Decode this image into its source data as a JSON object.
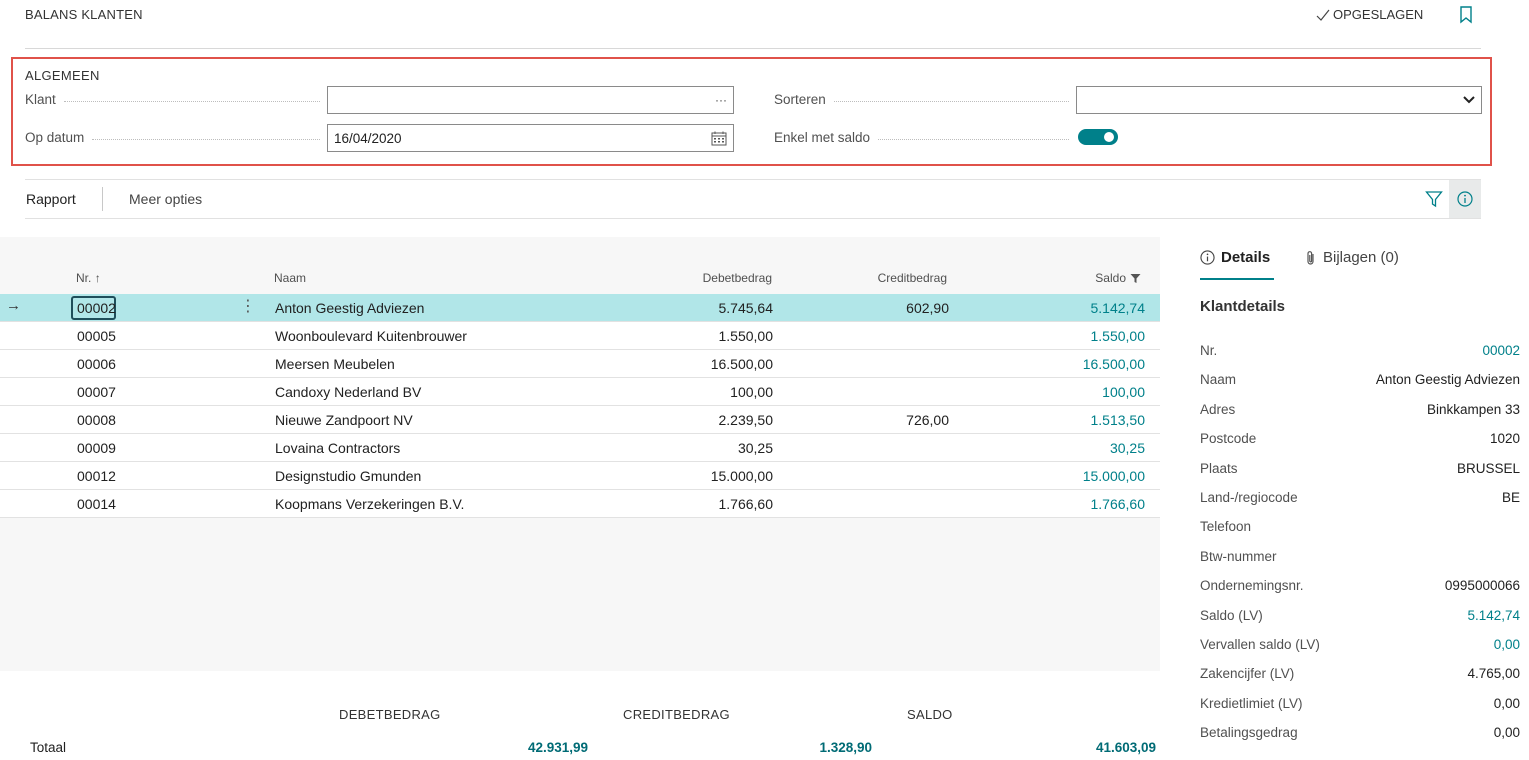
{
  "header": {
    "title": "BALANS KLANTEN",
    "saved_label": "OPGESLAGEN"
  },
  "general": {
    "title": "ALGEMEEN",
    "customer_label": "Klant",
    "customer_value": "",
    "customer_lookup": "···",
    "date_label": "Op datum",
    "date_value": "16/04/2020",
    "sort_label": "Sorteren",
    "sort_value": "",
    "only_balance_label": "Enkel met saldo",
    "only_balance_on": true
  },
  "actions": {
    "report": "Rapport",
    "more": "Meer opties"
  },
  "table": {
    "columns": {
      "nr": "Nr.",
      "nr_sort": "↑",
      "name": "Naam",
      "debit": "Debetbedrag",
      "credit": "Creditbedrag",
      "balance": "Saldo"
    },
    "selected_arrow": "→",
    "row_menu": "⋮",
    "rows": [
      {
        "nr": "00002",
        "name": "Anton Geestig Adviezen",
        "debit": "5.745,64",
        "credit": "602,90",
        "balance": "5.142,74"
      },
      {
        "nr": "00005",
        "name": "Woonboulevard Kuitenbrouwer",
        "debit": "1.550,00",
        "credit": "",
        "balance": "1.550,00"
      },
      {
        "nr": "00006",
        "name": "Meersen Meubelen",
        "debit": "16.500,00",
        "credit": "",
        "balance": "16.500,00"
      },
      {
        "nr": "00007",
        "name": "Candoxy Nederland BV",
        "debit": "100,00",
        "credit": "",
        "balance": "100,00"
      },
      {
        "nr": "00008",
        "name": "Nieuwe Zandpoort NV",
        "debit": "2.239,50",
        "credit": "726,00",
        "balance": "1.513,50"
      },
      {
        "nr": "00009",
        "name": "Lovaina Contractors",
        "debit": "30,25",
        "credit": "",
        "balance": "30,25"
      },
      {
        "nr": "00012",
        "name": "Designstudio Gmunden",
        "debit": "15.000,00",
        "credit": "",
        "balance": "15.000,00"
      },
      {
        "nr": "00014",
        "name": "Koopmans Verzekeringen B.V.",
        "debit": "1.766,60",
        "credit": "",
        "balance": "1.766,60"
      }
    ]
  },
  "totals": {
    "debit_header": "DEBETBEDRAG",
    "credit_header": "CREDITBEDRAG",
    "balance_header": "SALDO",
    "label": "Totaal",
    "debit": "42.931,99",
    "credit": "1.328,90",
    "balance": "41.603,09"
  },
  "details": {
    "tab_details": "Details",
    "tab_attachments": "Bijlagen (0)",
    "title": "Klantdetails",
    "fields": [
      {
        "label": "Nr.",
        "value": "00002",
        "link": true
      },
      {
        "label": "Naam",
        "value": "Anton Geestig Adviezen",
        "link": false
      },
      {
        "label": "Adres",
        "value": "Binkkampen 33",
        "link": false
      },
      {
        "label": "Postcode",
        "value": "1020",
        "link": false
      },
      {
        "label": "Plaats",
        "value": "BRUSSEL",
        "link": false
      },
      {
        "label": "Land-/regiocode",
        "value": "BE",
        "link": false
      },
      {
        "label": "Telefoon",
        "value": "",
        "link": false
      },
      {
        "label": "Btw-nummer",
        "value": "",
        "link": false
      },
      {
        "label": "Ondernemingsnr.",
        "value": "0995000066",
        "link": false
      },
      {
        "label": "Saldo (LV)",
        "value": "5.142,74",
        "link": true
      },
      {
        "label": "Vervallen saldo (LV)",
        "value": "0,00",
        "link": true
      },
      {
        "label": "Zakencijfer (LV)",
        "value": "4.765,00",
        "link": false
      },
      {
        "label": "Kredietlimiet (LV)",
        "value": "0,00",
        "link": false
      },
      {
        "label": "Betalingsgedrag",
        "value": "0,00",
        "link": false
      }
    ]
  },
  "colors": {
    "accent": "#00808a",
    "selected_row": "#b1e6e8",
    "highlight_border": "#e0524a"
  }
}
